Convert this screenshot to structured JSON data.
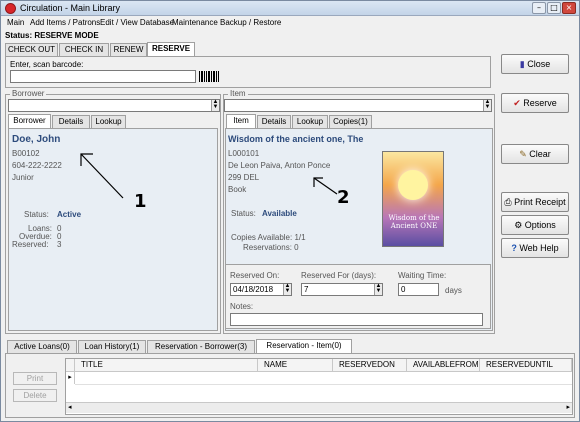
{
  "window": {
    "title": "Circulation - Main Library"
  },
  "menu": [
    "Main",
    "Add Items / Patrons",
    "Edit / View Database",
    "Maintenance",
    "Backup / Restore"
  ],
  "status": "Status: RESERVE MODE",
  "mode_tabs": [
    "CHECK OUT",
    "CHECK IN",
    "RENEW",
    "RESERVE"
  ],
  "scan": {
    "label": "Enter, scan barcode:",
    "value": ""
  },
  "borrower": {
    "group_label": "Borrower",
    "tabs": [
      "Borrower",
      "Details",
      "Lookup"
    ],
    "name": "Doe, John",
    "id": "B00102",
    "phone": "604-222-2222",
    "type": "Junior",
    "status_label": "Status:",
    "status_value": "Active",
    "loans_label": "Loans:",
    "loans_value": "0",
    "overdue_label": "Overdue:",
    "overdue_value": "0",
    "reserved_label": "Reserved:",
    "reserved_value": "3"
  },
  "item": {
    "group_label": "Item",
    "tabs": [
      "Item",
      "Details",
      "Lookup",
      "Copies(1)"
    ],
    "title": "Wisdom of the ancient one, The",
    "id": "L000101",
    "author": "De Leon Paiva, Anton Ponce",
    "call": "299 DEL",
    "type": "Book",
    "status_label": "Status:",
    "status_value": "Available",
    "copies": "Copies Available:  1/1",
    "reservations": "Reservations:  0",
    "cover_title": "Wisdom of the Ancient ONE"
  },
  "reserve": {
    "reserved_on_label": "Reserved On:",
    "reserved_on_value": "04/18/2018",
    "reserved_for_label": "Reserved For (days):",
    "reserved_for_value": "7",
    "waiting_label": "Waiting Time:",
    "waiting_value": "0",
    "waiting_unit": "days",
    "notes_label": "Notes:"
  },
  "side_buttons": {
    "close": "Close",
    "reserve": "Reserve",
    "clear": "Clear",
    "print_receipt": "Print Receipt",
    "options": "Options",
    "web_help": "Web Help"
  },
  "annotations": {
    "one": "1",
    "two": "2"
  },
  "bottom_tabs": [
    "Active Loans(0)",
    "Loan History(1)",
    "Reservation - Borrower(3)",
    "Reservation - Item(0)"
  ],
  "grid_columns": [
    "TITLE",
    "NAME",
    "RESERVEDON",
    "AVAILABLEFROM",
    "RESERVEDUNTIL"
  ],
  "bottom_buttons": {
    "print": "Print",
    "delete": "Delete"
  }
}
